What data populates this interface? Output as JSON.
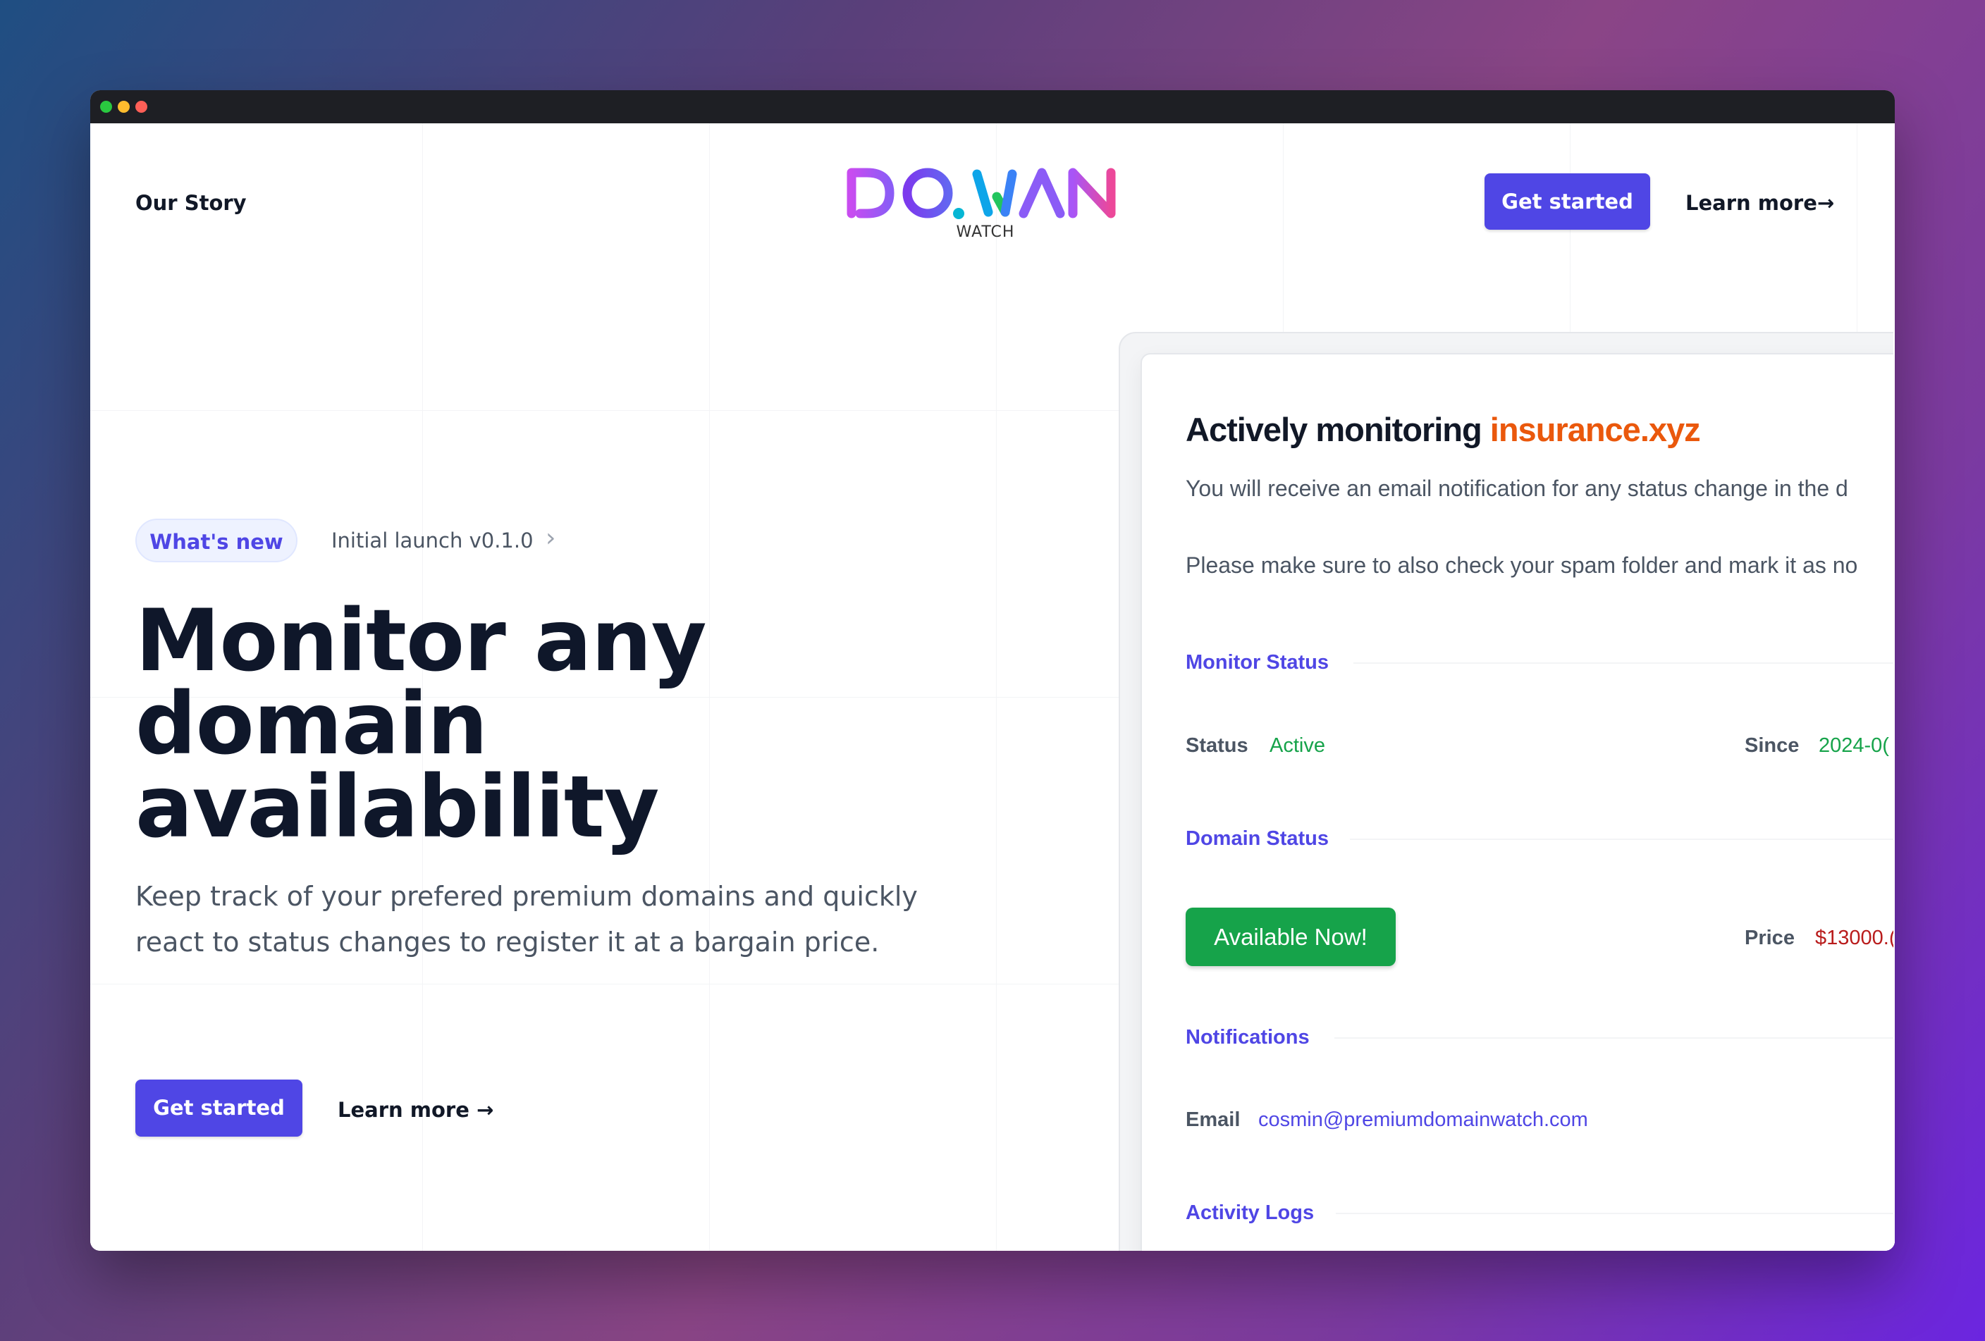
{
  "nav": {
    "our_story": "Our Story",
    "logo_text": "DOMAIN",
    "logo_sub": "WATCH",
    "get_started": "Get started",
    "learn_more": "Learn more→"
  },
  "hero": {
    "badge": "What's new",
    "launch": "Initial launch v0.1.0",
    "chevron": "›",
    "title": "Monitor any domain availability",
    "subtitle": "Keep track of your prefered premium domains and quickly react to status changes to register it at a bargain price.",
    "get_started": "Get started",
    "learn_more": "Learn more →"
  },
  "card": {
    "title_prefix": "Actively monitoring ",
    "domain": "insurance.xyz",
    "text1": "You will receive an email notification for any status change in the d",
    "text2": "Please make sure to also check your spam folder and mark it as no",
    "monitor_status": {
      "heading": "Monitor Status",
      "status_label": "Status",
      "status_value": "Active",
      "since_label": "Since",
      "since_value": "2024-0("
    },
    "domain_status": {
      "heading": "Domain Status",
      "available": "Available Now!",
      "price_label": "Price",
      "price_value": "$13000.("
    },
    "notifications": {
      "heading": "Notifications",
      "email_label": "Email",
      "email_value": "cosmin@premiumdomainwatch.com"
    },
    "activity_logs": {
      "heading": "Activity Logs"
    }
  },
  "colors": {
    "accent": "#4f46e5",
    "domain": "#ea580c",
    "success": "#16a34a",
    "price": "#b91c1c"
  }
}
